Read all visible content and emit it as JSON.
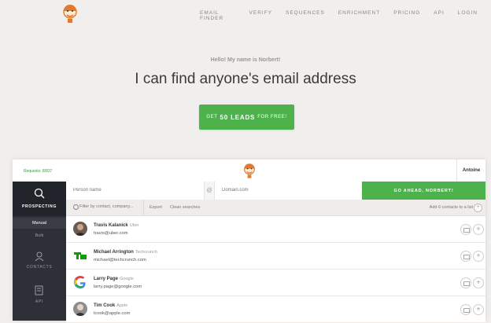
{
  "nav": {
    "items": [
      "EMAIL FINDER",
      "VERIFY",
      "SEQUENCES",
      "ENRICHMENT",
      "PRICING",
      "API",
      "LOGIN"
    ]
  },
  "hero": {
    "greeting": "Hello! My name is Norbert!",
    "headline": "I can find anyone's email address",
    "cta_pre": "GET",
    "cta_bold": "50 LEADS",
    "cta_post": "FOR FREE!"
  },
  "app": {
    "requests": "Requests: 8/837",
    "user": "Antoine",
    "sidebar": {
      "prospecting": "PROSPECTING",
      "manual": "Manual",
      "bulk": "Bulk",
      "contacts": "CONTACTS",
      "api": "API"
    },
    "search": {
      "name_placeholder": "Person name",
      "at": "@",
      "domain_placeholder": "Domain.com",
      "go": "GO AHEAD, NORBERT!"
    },
    "toolbar": {
      "filter_placeholder": "Filter by contact, company...",
      "export": "Export",
      "clean": "Clean searches",
      "add_to_list": "Add 6 contacts to a list",
      "plus": "+"
    },
    "contacts": [
      {
        "name": "Travis Kalanick",
        "company": "Uber",
        "email": "travis@uber.com"
      },
      {
        "name": "Michael Arrington",
        "company": "Techcrunch",
        "email": "michael@techcrunch.com"
      },
      {
        "name": "Larry Page",
        "company": "Google",
        "email": "larry.page@google.com"
      },
      {
        "name": "Tim Cook",
        "company": "Apple",
        "email": "tcook@apple.com"
      }
    ]
  },
  "colors": {
    "accent": "#4db24b",
    "sidebar": "#2e3038",
    "logo": "#e07a2f"
  }
}
